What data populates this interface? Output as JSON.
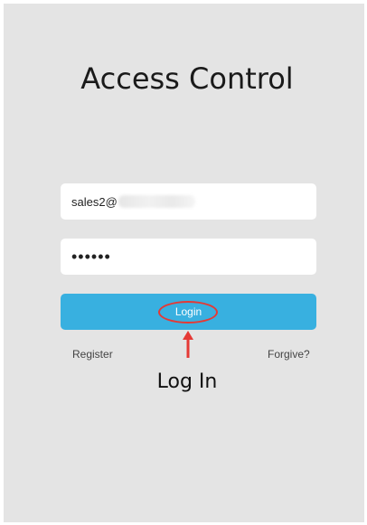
{
  "app": {
    "title": "Access Control"
  },
  "form": {
    "email_value": "sales2@",
    "password_value": "••••••",
    "login_label": "Login"
  },
  "links": {
    "register": "Register",
    "forgive": "Forgive?"
  },
  "annotation": {
    "caption": "Log In",
    "highlight_color": "#e53935"
  },
  "colors": {
    "background": "#e4e4e4",
    "button": "#38b0e0"
  }
}
